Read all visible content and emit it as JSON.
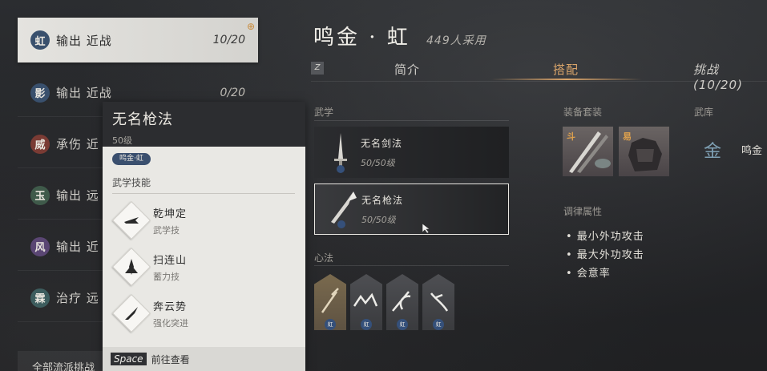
{
  "builds": [
    {
      "badge": "虹",
      "label": "输出 近战",
      "count": "10/20",
      "selected": true
    },
    {
      "badge": "影",
      "label": "输出 近战",
      "count": "0/20"
    },
    {
      "badge": "威",
      "label": "承伤 近",
      "count": ""
    },
    {
      "badge": "玉",
      "label": "输出 远",
      "count": ""
    },
    {
      "badge": "风",
      "label": "输出 近",
      "count": ""
    },
    {
      "badge": "霖",
      "label": "治疗 远",
      "count": ""
    }
  ],
  "all_link": "全部流派挑战",
  "popup": {
    "title": "无名枪法",
    "level": "50级",
    "tag": "鸣金·虹",
    "section": "武学技能",
    "skills": [
      {
        "name": "乾坤定",
        "type": "武学技"
      },
      {
        "name": "扫连山",
        "type": "蓄力技"
      },
      {
        "name": "奔云势",
        "type": "强化突进"
      }
    ],
    "key": "Space",
    "action": "前往查看"
  },
  "header": {
    "title": "鸣金 · 虹",
    "users": "449人采用"
  },
  "tabs": {
    "key": "Z",
    "items": [
      "简介",
      "搭配",
      "挑战(10/20)"
    ],
    "active": "搭配"
  },
  "sections": {
    "martial": "武学",
    "heart": "心法",
    "equip": "装备套装",
    "armory": "武库",
    "attributes": "调律属性"
  },
  "martial_arts": [
    {
      "name": "无名剑法",
      "level": "50/50级"
    },
    {
      "name": "无名枪法",
      "level": "50/50级",
      "selected": true
    }
  ],
  "heart_badges": [
    "虹",
    "虹",
    "虹",
    "虹"
  ],
  "equip_tags": [
    "斗",
    "易"
  ],
  "attributes": [
    "• 最小外功攻击",
    "• 最大外功攻击",
    "• 会意率"
  ],
  "armory": {
    "icon": "金",
    "name": "鸣金"
  },
  "colors": {
    "accent": "#d9a46a",
    "badge_blue": "#39506d"
  }
}
